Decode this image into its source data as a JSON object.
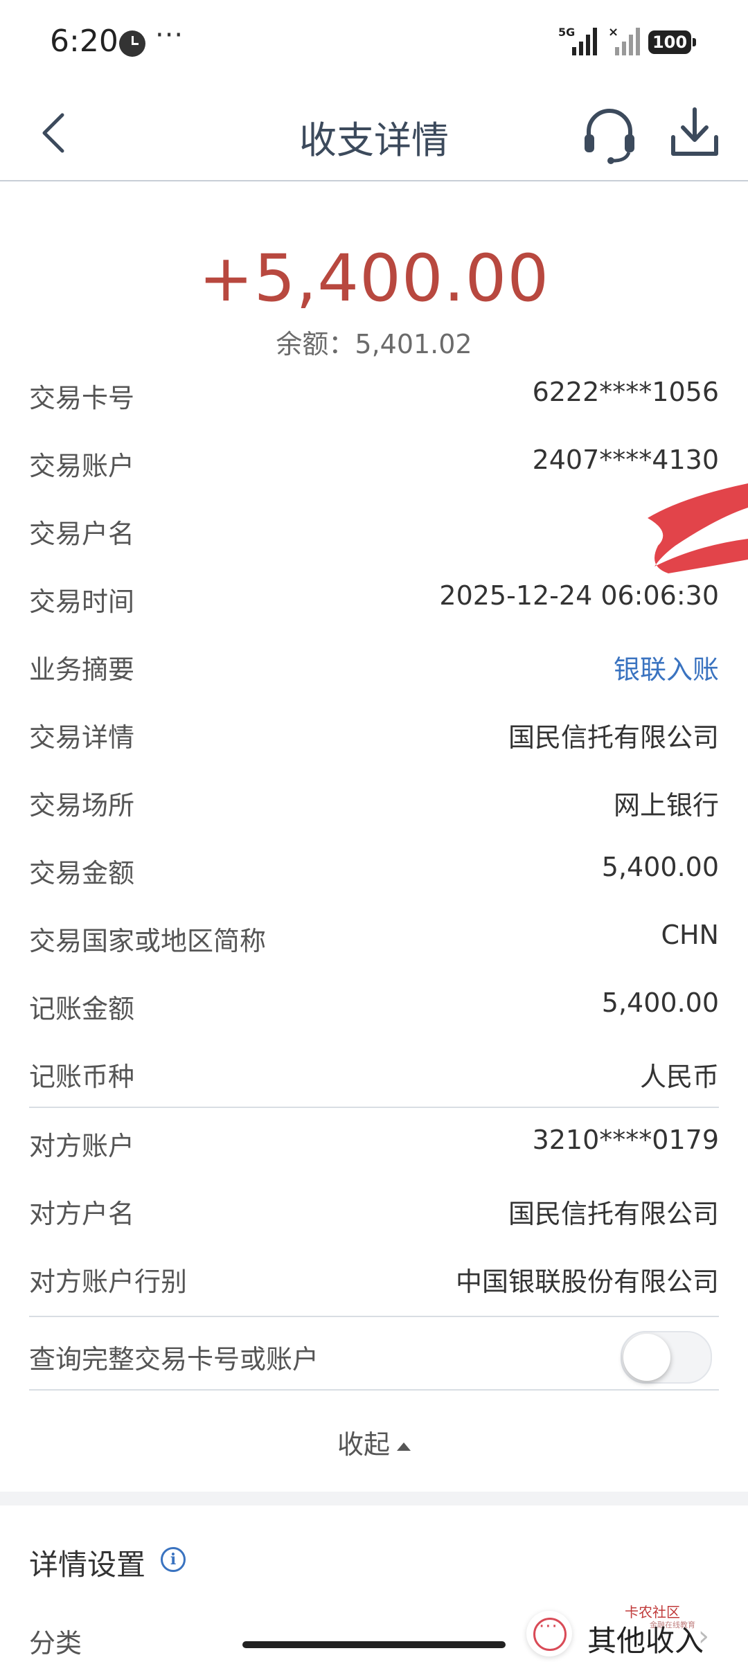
{
  "status_bar": {
    "time": "6:20",
    "more": "···",
    "network": "5G",
    "battery": "100"
  },
  "header": {
    "title": "收支详情",
    "back_icon": "chevron-left-icon",
    "support_icon": "headset-icon",
    "download_icon": "download-icon"
  },
  "summary": {
    "amount": "+5,400.00",
    "balance_label": "余额：",
    "balance": "5,401.02"
  },
  "details": [
    {
      "label": "交易卡号",
      "value": "6222****1056"
    },
    {
      "label": "交易账户",
      "value": "2407****4130"
    },
    {
      "label": "交易户名",
      "value": ""
    },
    {
      "label": "交易时间",
      "value": "2025-12-24 06:06:30"
    },
    {
      "label": "业务摘要",
      "value": "银联入账"
    },
    {
      "label": "交易详情",
      "value": "国民信托有限公司"
    },
    {
      "label": "交易场所",
      "value": "网上银行"
    },
    {
      "label": "交易金额",
      "value": "5,400.00"
    },
    {
      "label": "交易国家或地区简称",
      "value": "CHN"
    },
    {
      "label": "记账金额",
      "value": "5,400.00"
    },
    {
      "label": "记账币种",
      "value": "人民币"
    }
  ],
  "counterparty": [
    {
      "label": "对方账户",
      "value": "3210****0179"
    },
    {
      "label": "对方户名",
      "value": "国民信托有限公司"
    },
    {
      "label": "对方账户行别",
      "value": "中国银联股份有限公司"
    }
  ],
  "full_number_toggle": {
    "label": "查询完整交易卡号或账户",
    "enabled": false
  },
  "collapse_label": "收起",
  "settings": {
    "title": "详情设置",
    "category_label": "分类",
    "category_value": "其他收入"
  },
  "watermark": {
    "text": "卡农社区",
    "sub": "金融在线教育"
  },
  "colors": {
    "amount": "#b8483f",
    "link": "#3a73c0",
    "title": "#3c4a5c",
    "accent": "#d94b57"
  }
}
